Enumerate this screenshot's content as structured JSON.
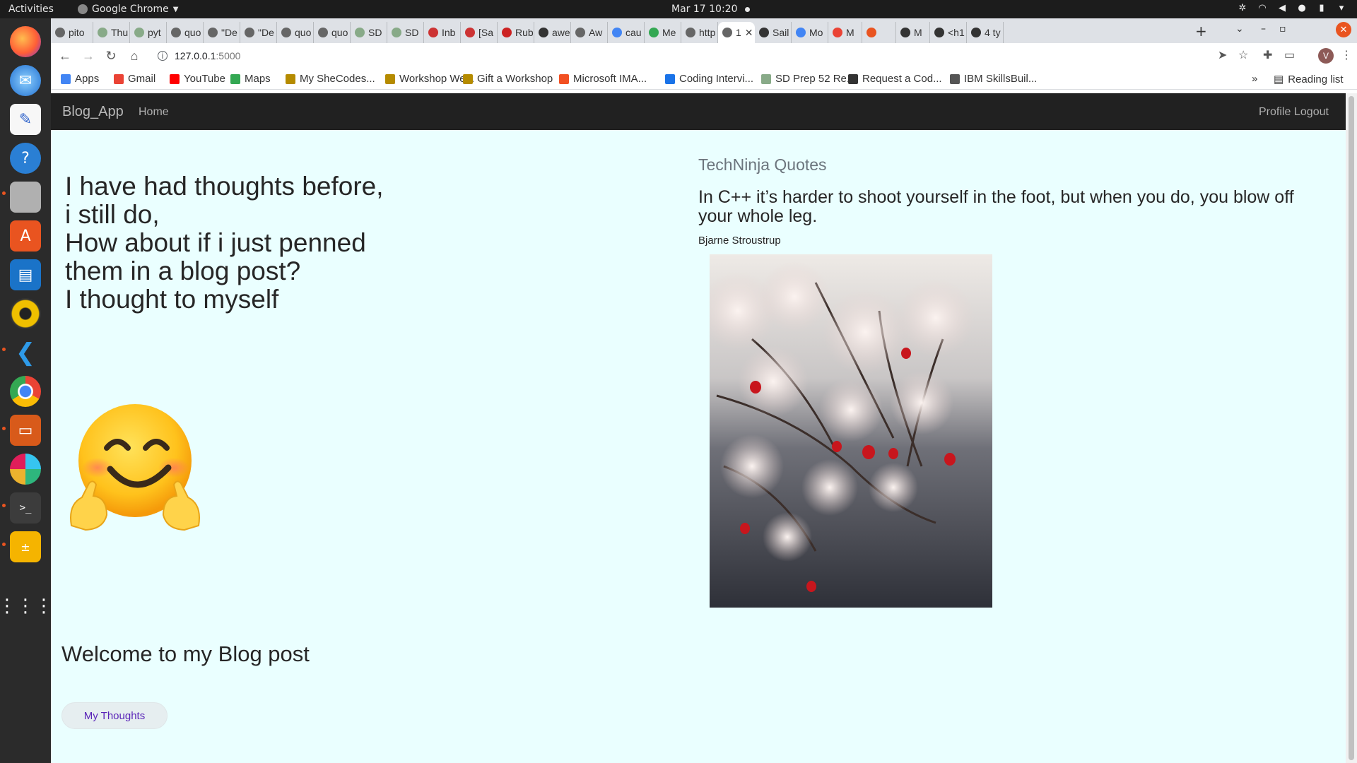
{
  "system": {
    "activities": "Activities",
    "app_name": "Google Chrome",
    "clock": "Mar 17  10:20"
  },
  "tabs": [
    {
      "label": "pito",
      "color": "#666"
    },
    {
      "label": "Thu",
      "color": "#8a8"
    },
    {
      "label": "pyt",
      "color": "#8a8"
    },
    {
      "label": "quo",
      "color": "#666"
    },
    {
      "label": "\"De",
      "color": "#666"
    },
    {
      "label": "\"De",
      "color": "#666"
    },
    {
      "label": "quo",
      "color": "#666"
    },
    {
      "label": "quo",
      "color": "#666"
    },
    {
      "label": "SD",
      "color": "#8a8"
    },
    {
      "label": "SD",
      "color": "#8a8"
    },
    {
      "label": "Inb",
      "color": "#c33"
    },
    {
      "label": "[Sa",
      "color": "#c33"
    },
    {
      "label": "Rub",
      "color": "#c22"
    },
    {
      "label": "awe",
      "color": "#333"
    },
    {
      "label": "Aw",
      "color": "#666"
    },
    {
      "label": "cau",
      "color": "#4285f4"
    },
    {
      "label": "Me",
      "color": "#34a853"
    },
    {
      "label": "http",
      "color": "#666"
    },
    {
      "label": "1",
      "color": "#666"
    },
    {
      "label": "Sail",
      "color": "#333"
    },
    {
      "label": "Mo",
      "color": "#4285f4"
    },
    {
      "label": "M",
      "color": "#ea4335"
    },
    {
      "label": "",
      "color": "#e95420"
    },
    {
      "label": "M",
      "color": "#333"
    },
    {
      "label": "<h1",
      "color": "#333"
    },
    {
      "label": "4 ty",
      "color": "#333"
    }
  ],
  "address": {
    "host": "127.0.0.1",
    "port": ":5000"
  },
  "bookmarks": [
    {
      "label": "Apps",
      "color": "#4285f4"
    },
    {
      "label": "Gmail",
      "color": "#ea4335"
    },
    {
      "label": "YouTube",
      "color": "#ff0000"
    },
    {
      "label": "Maps",
      "color": "#34a853"
    },
    {
      "label": "My SheCodes...",
      "color": "#b58b00"
    },
    {
      "label": "Workshop We...",
      "color": "#b58b00"
    },
    {
      "label": "Gift a Workshop",
      "color": "#b58b00"
    },
    {
      "label": "Microsoft IMA...",
      "color": "#f25022"
    },
    {
      "label": "Coding Intervi...",
      "color": "#1a73e8"
    },
    {
      "label": "SD Prep 52 Re...",
      "color": "#8a8"
    },
    {
      "label": "Request a Cod...",
      "color": "#333"
    },
    {
      "label": "IBM SkillsBuil...",
      "color": "#555"
    }
  ],
  "reading_list": "Reading list",
  "site": {
    "brand": "Blog_App",
    "nav_home": "Home",
    "nav_profile": "Profile",
    "nav_logout": "Logout",
    "intro_lines": [
      "I have had thoughts before,",
      "i still do,",
      "How about if i just penned",
      "them in a blog post?",
      "I thought to myself"
    ],
    "welcome": "Welcome to my Blog post",
    "thoughts_button": "My Thoughts",
    "quote_heading": "TechNinja Quotes",
    "quote_text": "In C++ it’s harder to shoot yourself in the foot, but when you do, you blow off your whole leg.",
    "quote_author": "Bjarne Stroustrup"
  },
  "colors": {
    "page_bg": "#eaffff",
    "navbar_bg": "#212121",
    "button_text": "#5a24b8"
  }
}
